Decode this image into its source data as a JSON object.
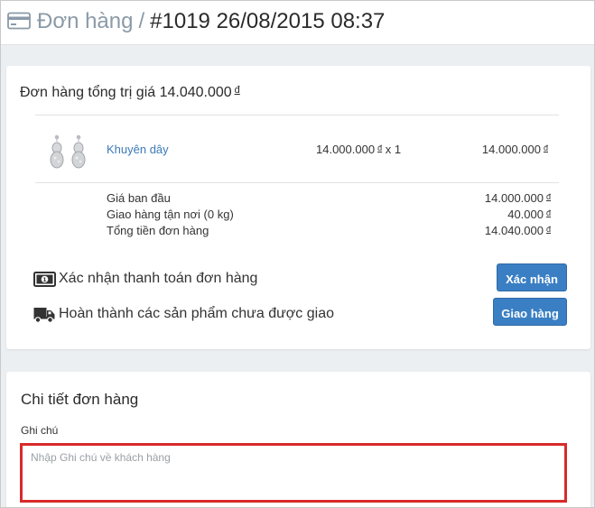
{
  "header": {
    "back_label": "Đơn hàng",
    "separator": "/",
    "current_title": "#1019 26/08/2015 08:37"
  },
  "order_summary": {
    "heading": "Đơn hàng tổng trị giá 14.040.000",
    "currency_symbol": "đ",
    "item": {
      "name": "Khuyên dây",
      "unit_price": "14.000.000",
      "qty_text": "x 1",
      "total": "14.000.000"
    },
    "totals": [
      {
        "label": "Giá ban đầu",
        "value": "14.000.000"
      },
      {
        "label": "Giao hàng tận nơi (0 kg)",
        "value": "40.000"
      },
      {
        "label": "Tổng tiền đơn hàng",
        "value": "14.040.000"
      }
    ]
  },
  "actions": {
    "payment_text": "Xác nhận thanh toán đơn hàng",
    "payment_button": "Xác nhận",
    "shipping_text": "Hoàn thành các sản phẩm chưa được giao",
    "shipping_button": "Giao hàng"
  },
  "details": {
    "title": "Chi tiết đơn hàng",
    "note_label": "Ghi chú",
    "note_placeholder": "Nhập Ghi chú về khách hàng",
    "note_value": ""
  },
  "icons": {
    "header": "credit-card-icon",
    "payment": "money-bill-icon",
    "shipping": "truck-icon"
  },
  "colors": {
    "accent": "#3a7fc4",
    "link": "#3c7ab8",
    "highlight_border": "#d92a2a",
    "muted_breadcrumb": "#8a9aa8"
  }
}
